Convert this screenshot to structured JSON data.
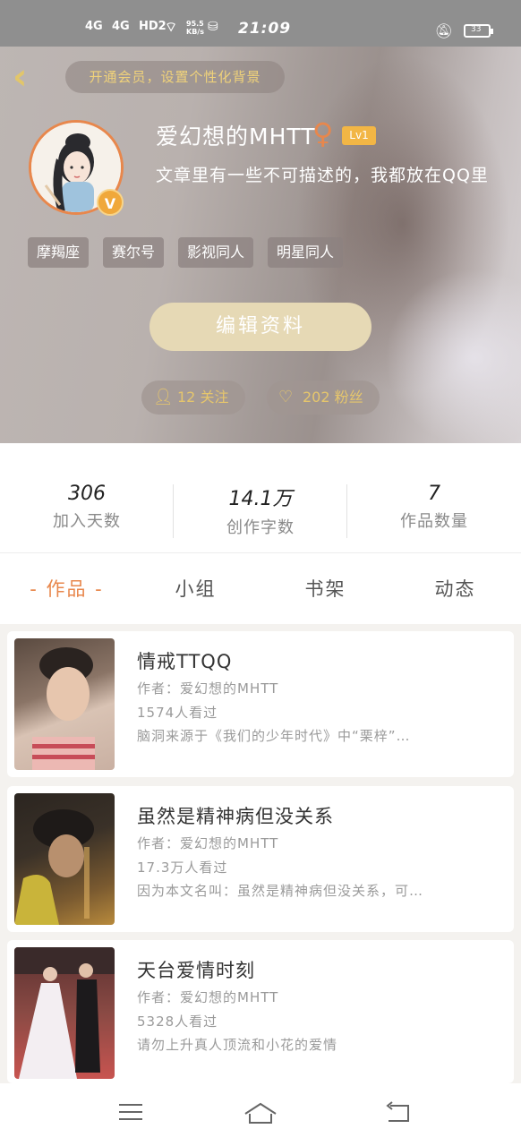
{
  "status_bar": {
    "signal1": "4G",
    "signal2": "4G",
    "hd": "HD2",
    "speed": "95.5 KB/s",
    "time": "21:09",
    "battery": "33"
  },
  "header": {
    "vip_prompt": "开通会员，设置个性化背景",
    "username": "爱幻想的MHTT",
    "gender_symbol": "♀",
    "level": "Lv1",
    "bio": "文章里有一些不可描述的，我都放在QQ里",
    "verified_badge": "V",
    "tags": [
      "摩羯座",
      "赛尔号",
      "影视同人",
      "明星同人"
    ],
    "edit_button": "编辑资料",
    "following": "12 关注",
    "fans": "202 粉丝"
  },
  "stats": [
    {
      "value": "306",
      "label": "加入天数"
    },
    {
      "value": "14.1万",
      "label": "创作字数"
    },
    {
      "value": "7",
      "label": "作品数量"
    }
  ],
  "tabs": [
    "- 作品 -",
    "小组",
    "书架",
    "动态"
  ],
  "works": [
    {
      "title": "情戒TTQQ",
      "author": "作者：爱幻想的MHTT",
      "views": "1574人看过",
      "summary": "脑洞来源于《我们的少年时代》中“栗梓”…"
    },
    {
      "title": "虽然是精神病但没关系",
      "author": "作者：爱幻想的MHTT",
      "views": "17.3万人看过",
      "summary": "因为本文名叫：虽然是精神病但没关系，可…"
    },
    {
      "title": "天台爱情时刻",
      "author": "作者：爱幻想的MHTT",
      "views": "5328人看过",
      "summary": "请勿上升真人顶流和小花的爱情"
    }
  ],
  "colors": {
    "accent": "#e8874c",
    "gold": "#e6c66c",
    "edit_button_bg": "#e6d9b5"
  },
  "icons": {
    "back": "chevron-left-icon",
    "menu": "menu-icon",
    "home": "home-icon",
    "return": "return-icon"
  }
}
